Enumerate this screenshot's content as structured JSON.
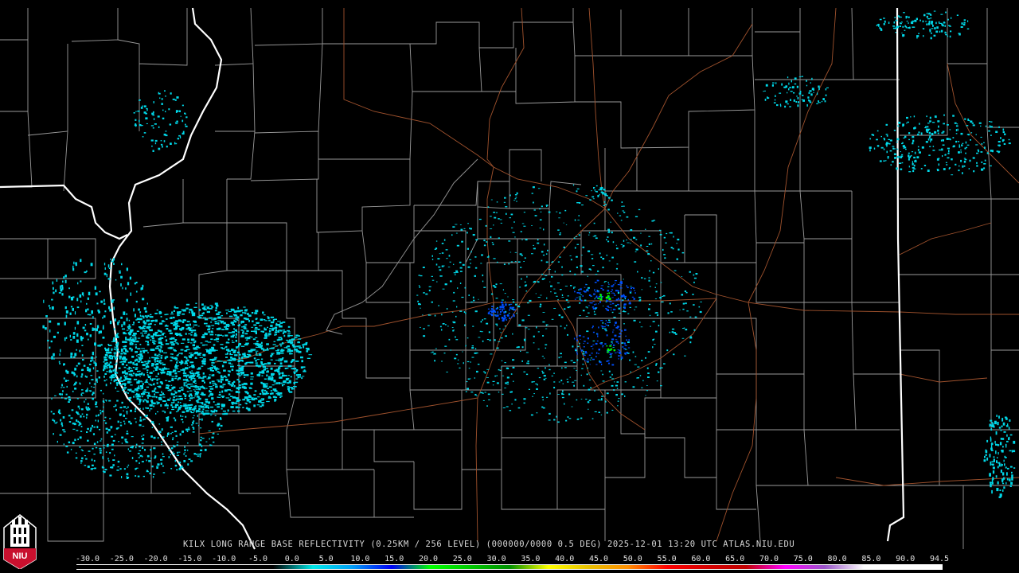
{
  "product": {
    "caption": "KILX LONG RANGE BASE REFLECTIVITY (0.25KM / 256 LEVEL) (000000/0000 0.5 DEG) 2025-12-01 13:20 UTC  ATLAS.NIU.EDU"
  },
  "logo": {
    "text": "NIU",
    "icon": "niu-tower-icon",
    "colors": {
      "background": "#c8102e",
      "foreground": "#ffffff"
    }
  },
  "legend": {
    "labels": [
      "-30.0",
      "-25.0",
      "-20.0",
      "-15.0",
      "-10.0",
      "-5.0",
      "0.0",
      "5.0",
      "10.0",
      "15.0",
      "20.0",
      "25.0",
      "30.0",
      "35.0",
      "40.0",
      "45.0",
      "50.0",
      "55.0",
      "60.0",
      "65.0",
      "70.0",
      "75.0",
      "80.0",
      "85.0",
      "90.0",
      "94.5"
    ],
    "colors": [
      "#000000",
      "#000000",
      "#000000",
      "#000000",
      "#000000",
      "#000000",
      "#00e8e8",
      "#00a0f6",
      "#0000f6",
      "#00ff00",
      "#00c800",
      "#009000",
      "#ffff00",
      "#e7c000",
      "#ff9000",
      "#ff0000",
      "#d60000",
      "#c00000",
      "#ff00ff",
      "#9955c9",
      "#ffffff",
      "#ffffff"
    ]
  },
  "map_colors": {
    "county_lines": "#9a9a9a",
    "state_lines": "#ffffff",
    "highways": "#a0522d",
    "echo_cyan": "#00d8e8",
    "echo_blue": "#0050ff",
    "echo_green": "#00ff00"
  }
}
